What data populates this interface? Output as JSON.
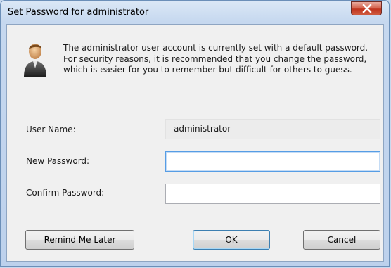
{
  "dialog": {
    "title": "Set Password for administrator",
    "close_glyph": "X",
    "icon": "user-icon",
    "message": "The administrator user account is currently set with a default password. For security reasons, it is recommended that you change the password, which is easier for you to remember but difficult for others to guess."
  },
  "form": {
    "username_label": "User Name:",
    "username_value": "administrator",
    "new_password_label": "New Password:",
    "new_password_value": "",
    "confirm_password_label": "Confirm Password:",
    "confirm_password_value": ""
  },
  "buttons": {
    "remind_later": "Remind Me Later",
    "ok": "OK",
    "cancel": "Cancel"
  },
  "colors": {
    "title_bar": "#c6d8ef",
    "close_button": "#c0341e",
    "client_bg": "#f0f0f0",
    "focus_border": "#569de5"
  }
}
